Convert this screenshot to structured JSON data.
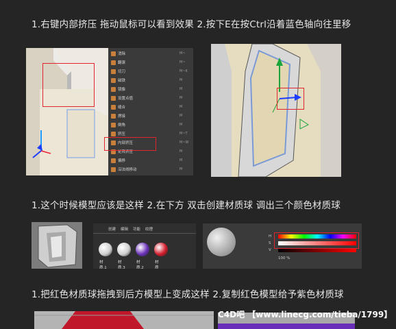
{
  "steps": [
    "1.右键内部挤压 拖动鼠标可以看到效果  2.按下E在按Ctrl沿着蓝色轴向往里移",
    "1.这个时候模型应该是这样 2.在下方 双击创建材质球 调出三个颜色材质球",
    "1.把红色材质球拖拽到后方模型上变成这样 2.复制红色模型给予紫色材质球"
  ],
  "context_menu": {
    "items": [
      {
        "label": "消除",
        "shortcut": "M~"
      },
      {
        "label": "翻滚",
        "shortcut": "M~"
      },
      {
        "label": "切刀",
        "shortcut": "M~K"
      },
      {
        "label": "磁铁",
        "shortcut": "M"
      },
      {
        "label": "镜像",
        "shortcut": "M"
      },
      {
        "label": "设置点值",
        "shortcut": "M"
      },
      {
        "label": "缝合",
        "shortcut": "M"
      },
      {
        "label": "焊接",
        "shortcut": "M"
      },
      {
        "label": "倒角",
        "shortcut": "M"
      },
      {
        "label": "挤压",
        "shortcut": "M~T"
      },
      {
        "label": "内部挤压",
        "shortcut": "M~W"
      },
      {
        "label": "矩阵挤压",
        "shortcut": "M"
      },
      {
        "label": "偏移",
        "shortcut": "M"
      },
      {
        "label": "沿法线移动",
        "shortcut": "M"
      }
    ]
  },
  "material_panel": {
    "tabs": [
      "创建",
      "编辑",
      "功能",
      "纹理"
    ],
    "materials": [
      {
        "label": "材质.1",
        "color": "#d0d0d0"
      },
      {
        "label": "材质.3",
        "color": "#d0d0d0"
      },
      {
        "label": "材质.2",
        "color": "#6a2fb8"
      },
      {
        "label": "材质",
        "color": "#d21b2a"
      }
    ]
  },
  "color_panel": {
    "rows": [
      "H",
      "S",
      "V"
    ],
    "percent": "100 %"
  },
  "colors": {
    "background": "#252525",
    "highlight": "#e0252f"
  },
  "watermark": "C4D吧 【www.linecg.com/tieba/1799】"
}
